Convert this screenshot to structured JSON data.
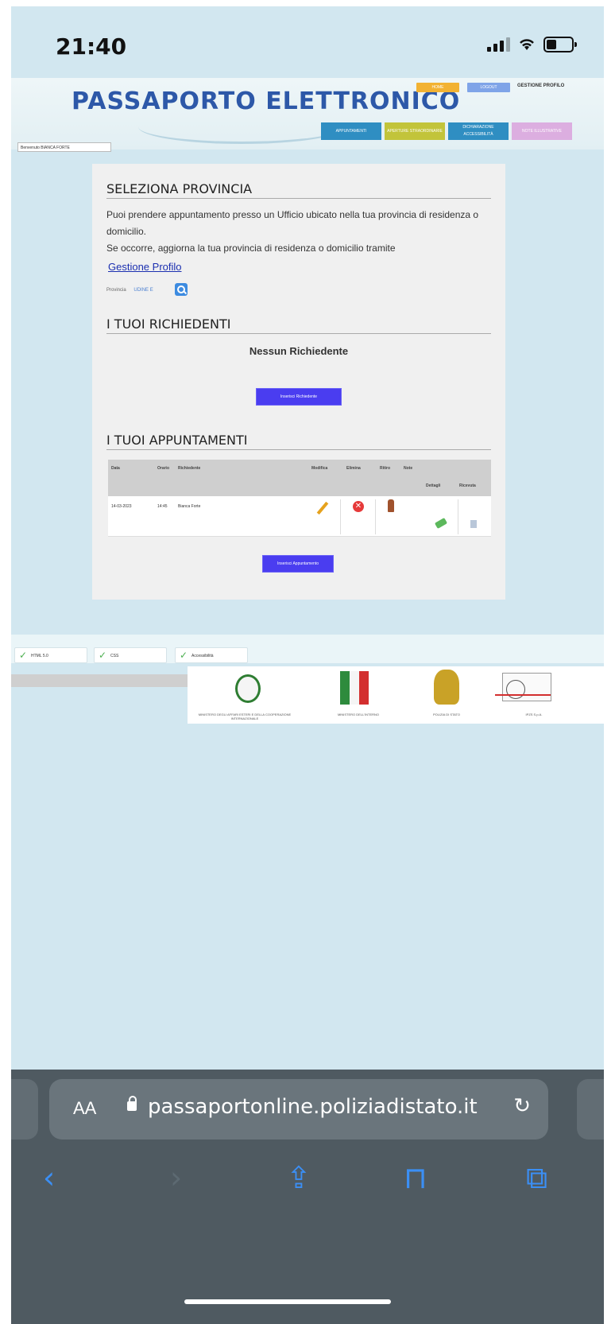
{
  "status_bar": {
    "time": "21:40"
  },
  "header": {
    "title": "PASSAPORTO ELETTRONICO",
    "top_buttons": [
      {
        "label": "HOME",
        "color": "#f2b233"
      },
      {
        "label": "LOGOUT",
        "color": "#7fa4e8"
      }
    ],
    "profile_link": "GESTIONE PROFILO",
    "nav": [
      {
        "label": "APPUNTAMENTI",
        "color": "#2f8ec2"
      },
      {
        "label": "APERTURE STRAORDINARIE",
        "color": "#c2c43a"
      },
      {
        "label": "DICHIARAZIONE ACCESSIBILITÀ",
        "color": "#2f8ec2"
      },
      {
        "label": "NOTE ILLUSTRATIVE",
        "color": "#dcaee0"
      }
    ],
    "welcome": "Benvenuto BIANCA FORTE"
  },
  "provincia": {
    "heading": "SELEZIONA PROVINCIA",
    "text1": "Puoi prendere appuntamento presso un Ufficio ubicato nella tua provincia di residenza o domicilio.",
    "text2": "Se occorre, aggiorna la tua provincia di residenza o domicilio tramite",
    "link": "Gestione Profilo",
    "label": "Provincia",
    "value": "UDINE E"
  },
  "richiedenti": {
    "heading": "I TUOI RICHIEDENTI",
    "empty": "Nessun Richiedente",
    "button": "Inserisci Richiedente"
  },
  "appuntamenti": {
    "heading": "I TUOI APPUNTAMENTI",
    "columns": [
      "Data",
      "Orario",
      "Richiedente",
      "Modifica",
      "Elimina",
      "Ritiro",
      "Note",
      "Dettagli",
      "Ricevuta"
    ],
    "rows": [
      {
        "date": "14-03-2023",
        "time": "14:45",
        "name": "Bianca Forte"
      }
    ],
    "button": "Inserisci Appuntamento"
  },
  "footer": {
    "badges": [
      "HTML 5.0",
      "CSS",
      "Accessibilità"
    ],
    "logos": [
      "MINISTERO DEGLI AFFARI ESTERI E DELLA COOPERAZIONE INTERNAZIONALE",
      "MINISTERO DELL'INTERNO",
      "POLIZIA DI STATO",
      "IPZS S.p.A."
    ]
  },
  "browser": {
    "aa": "AA",
    "url": "passaportonline.poliziadistato.it",
    "reload": "↻",
    "toolbar": {
      "back": "‹",
      "forward": "›",
      "share": "⇪",
      "bookmarks": "⊓",
      "tabs": "⧉"
    }
  }
}
